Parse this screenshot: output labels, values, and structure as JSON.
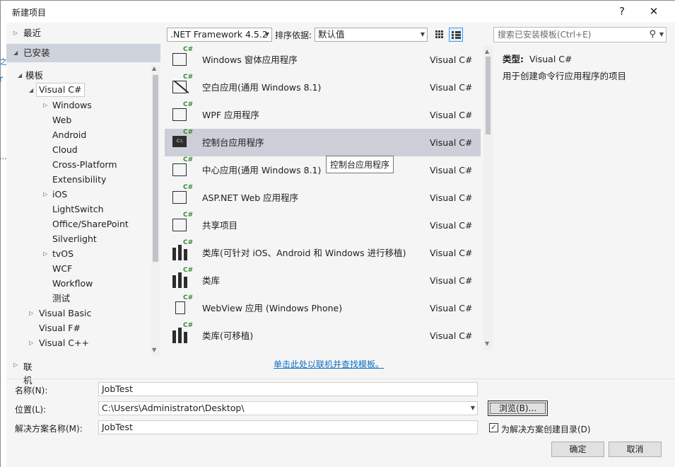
{
  "window": {
    "title": "新建项目",
    "help": "?",
    "close": "✕"
  },
  "background_fragments": [
    "之",
    "r",
    "...."
  ],
  "tree": {
    "recent": "最近",
    "installed": "已安装",
    "templates": "模板",
    "visual_csharp": "Visual C#",
    "children": [
      "Windows",
      "Web",
      "Android",
      "Cloud",
      "Cross-Platform",
      "Extensibility",
      "iOS",
      "LightSwitch",
      "Office/SharePoint",
      "Silverlight",
      "tvOS",
      "WCF",
      "Workflow",
      "测试"
    ],
    "visual_basic": "Visual Basic",
    "visual_fsharp": "Visual F#",
    "visual_cpp": "Visual C++",
    "online": "联机"
  },
  "toolbar": {
    "framework": ".NET Framework 4.5.2",
    "sort_label": "排序依据:",
    "sort_value": "默认值",
    "search_placeholder": "搜索已安装模板(Ctrl+E)"
  },
  "templates": [
    {
      "name": "Windows 窗体应用程序",
      "lang": "Visual C#",
      "icon": "winforms-icon"
    },
    {
      "name": "空白应用(通用 Windows 8.1)",
      "lang": "Visual C#",
      "icon": "blank-app-icon"
    },
    {
      "name": "WPF 应用程序",
      "lang": "Visual C#",
      "icon": "wpf-icon"
    },
    {
      "name": "控制台应用程序",
      "lang": "Visual C#",
      "icon": "console-icon",
      "selected": true
    },
    {
      "name": "中心应用(通用 Windows 8.1)",
      "lang": "Visual C#",
      "icon": "hub-app-icon"
    },
    {
      "name": "ASP.NET Web 应用程序",
      "lang": "Visual C#",
      "icon": "web-app-icon"
    },
    {
      "name": "共享项目",
      "lang": "Visual C#",
      "icon": "shared-project-icon"
    },
    {
      "name": "类库(可针对 iOS、Android 和 Windows 进行移植)",
      "lang": "Visual C#",
      "icon": "portable-library-icon"
    },
    {
      "name": "类库",
      "lang": "Visual C#",
      "icon": "class-library-icon"
    },
    {
      "name": "WebView 应用 (Windows Phone)",
      "lang": "Visual C#",
      "icon": "webview-app-icon"
    },
    {
      "name": "类库(可移植)",
      "lang": "Visual C#",
      "icon": "portable-class-library-icon"
    }
  ],
  "tooltip": "控制台应用程序",
  "info": {
    "type_label": "类型:",
    "type_value": "Visual C#",
    "description": "用于创建命令行应用程序的项目"
  },
  "online_link": "单击此处以联机并查找模板。",
  "form": {
    "name_label": "名称(N):",
    "name_value": "JobTest",
    "location_label": "位置(L):",
    "location_value": "C:\\Users\\Administrator\\Desktop\\",
    "browse": "浏览(B)...",
    "solution_label": "解决方案名称(M):",
    "solution_value": "JobTest",
    "create_dir_label": "为解决方案创建目录(D)",
    "create_dir_checked": true
  },
  "buttons": {
    "ok": "确定",
    "cancel": "取消"
  }
}
